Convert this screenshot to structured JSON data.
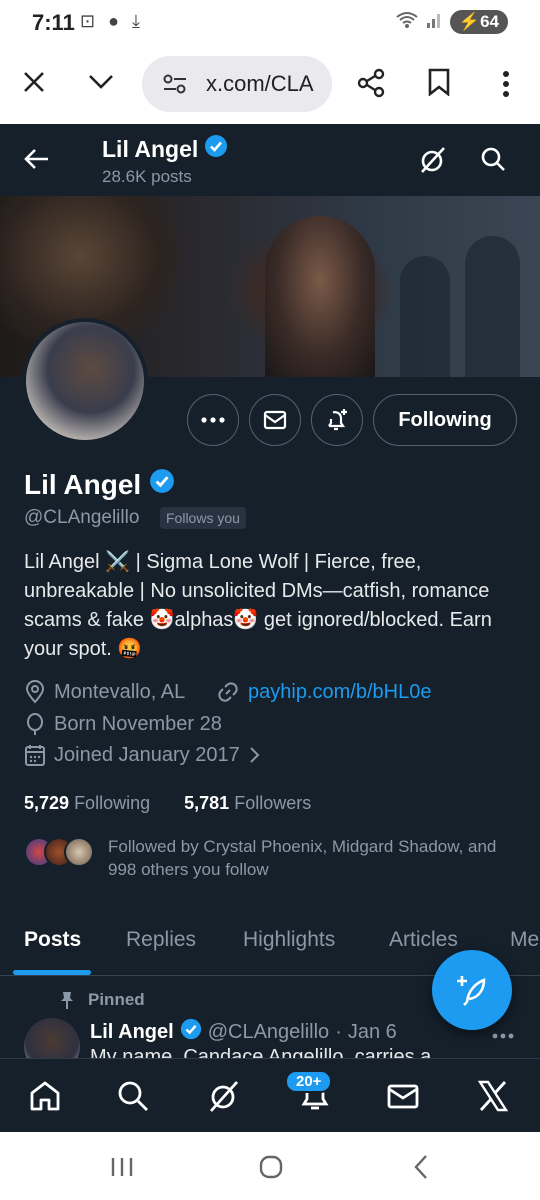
{
  "status_bar": {
    "time": "7:11",
    "battery": "64"
  },
  "browser": {
    "url": "x.com/CLA"
  },
  "header": {
    "name": "Lil Angel",
    "posts_count": "28.6K posts"
  },
  "profile": {
    "display_name": "Lil Angel",
    "handle": "@CLAngelillo",
    "follows_you": "Follows you",
    "bio": "Lil Angel ⚔️ | Sigma Lone Wolf | Fierce, free, unbreakable | No unsolicited DMs—catfish, romance scams & fake 🤡alphas🤡 get ignored/blocked. Earn your spot. 🤬",
    "location": "Montevallo, AL",
    "website": "payhip.com/b/bHL0e",
    "birthday": "Born November 28",
    "joined": "Joined January 2017",
    "following_count": "5,729",
    "following_label": "Following",
    "followers_count": "5,781",
    "followers_label": "Followers",
    "followed_by": "Followed by Crystal Phoenix, Midgard Shadow, and 998 others you follow",
    "following_button": "Following"
  },
  "tabs": [
    {
      "label": "Posts",
      "active": true
    },
    {
      "label": "Replies"
    },
    {
      "label": "Highlights"
    },
    {
      "label": "Articles"
    },
    {
      "label": "Me"
    }
  ],
  "pinned_post": {
    "pinned_label": "Pinned",
    "name": "Lil Angel",
    "handle": "@CLAngelillo",
    "separator": "·",
    "date": "Jan 6",
    "text_partial": "My name, Candace Angelillo, carries a"
  },
  "bottom_nav": {
    "notifications_badge": "20+"
  },
  "colors": {
    "background": "#15202b",
    "accent": "#1d9bf0",
    "muted": "#8b98a5"
  }
}
